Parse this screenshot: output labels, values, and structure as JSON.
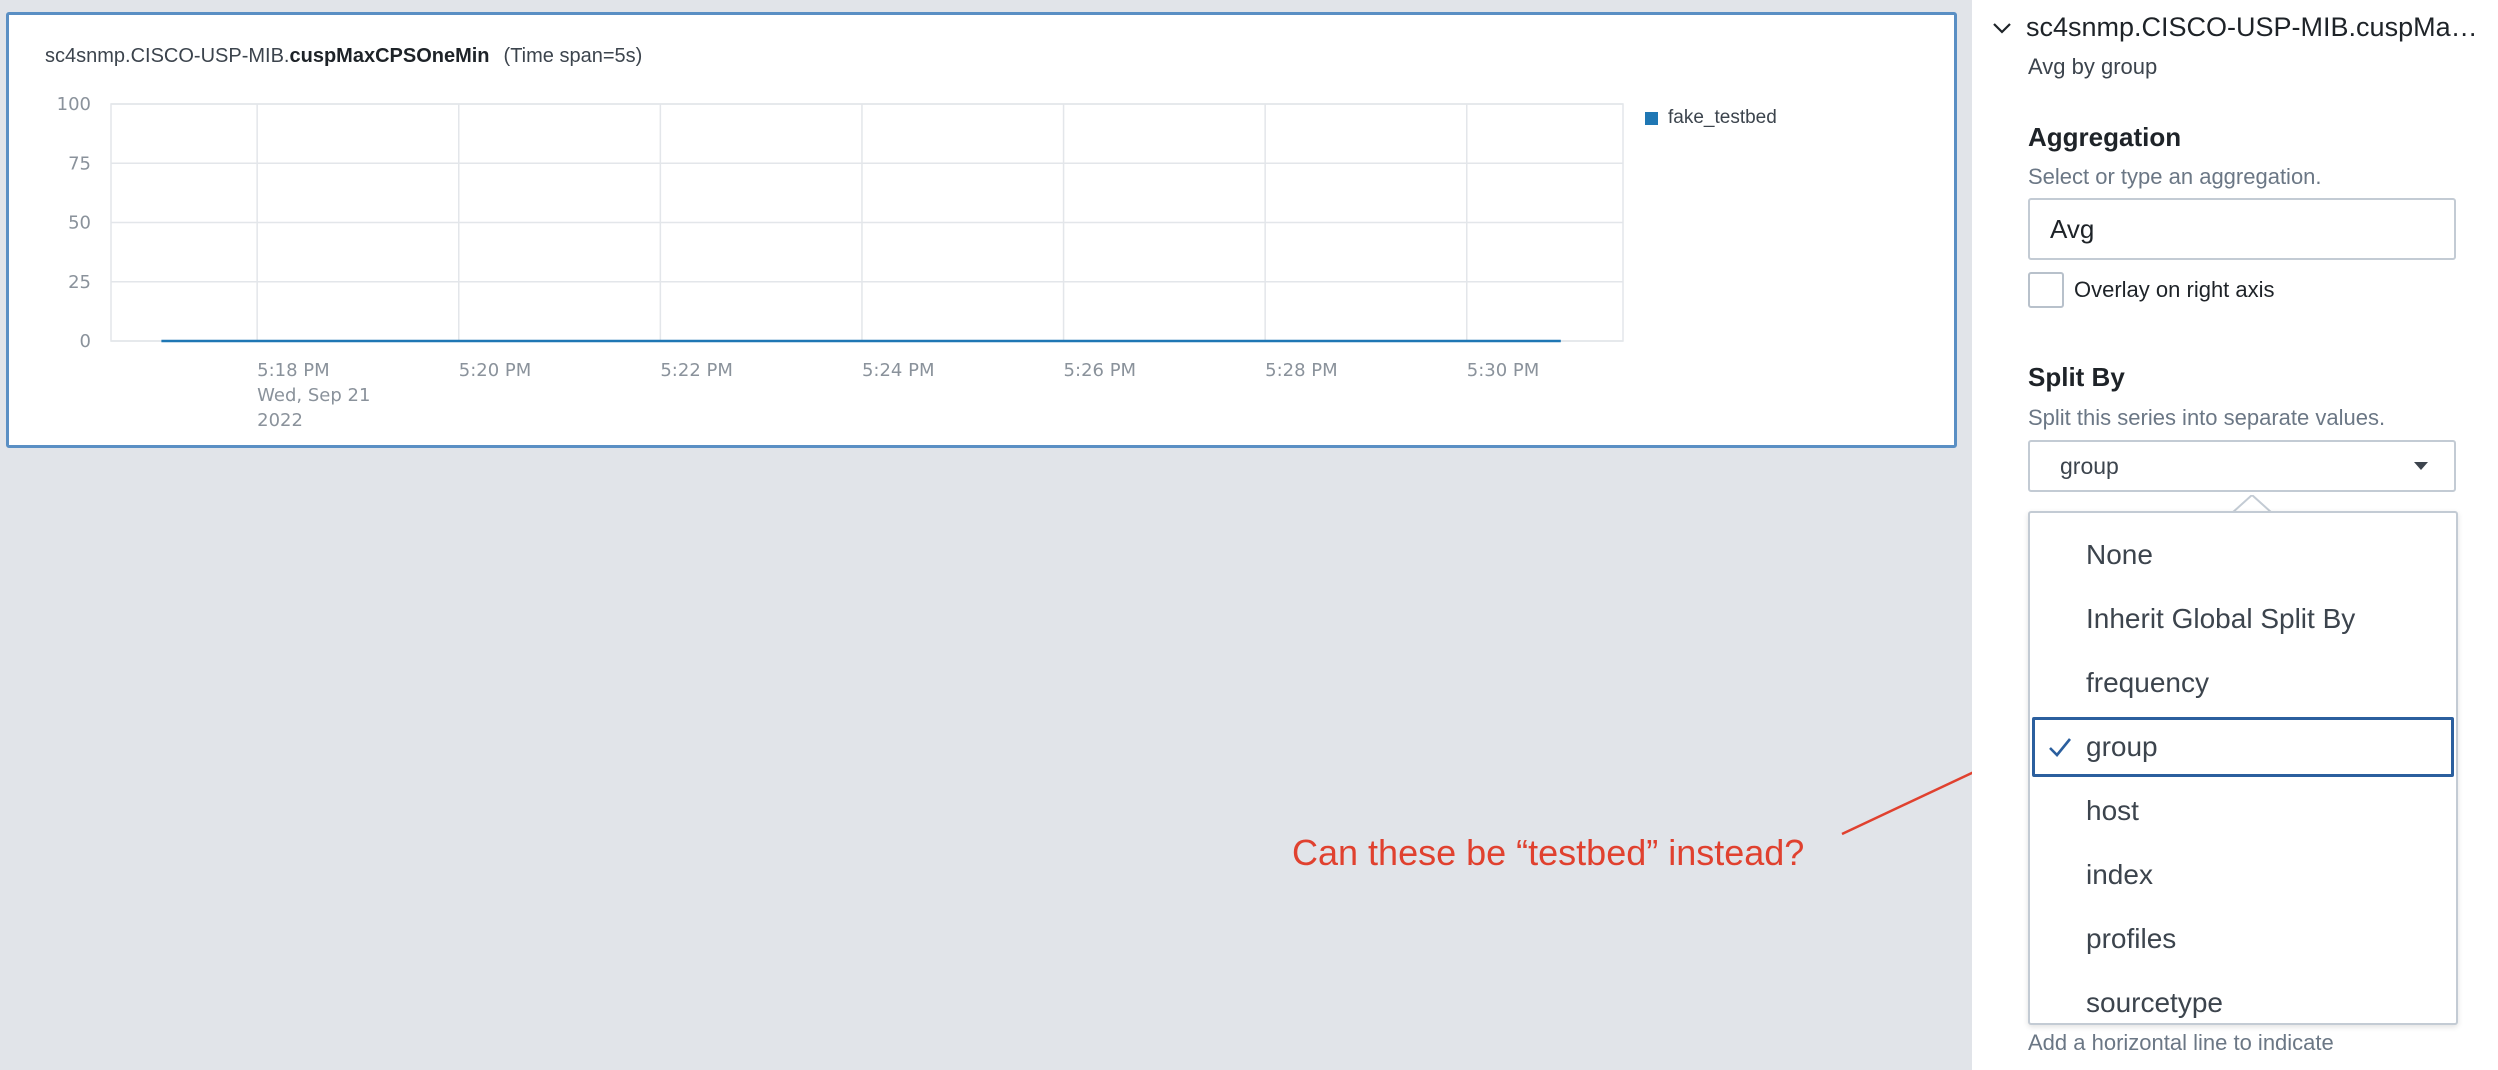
{
  "chart": {
    "metric_prefix": "sc4snmp.CISCO-USP-MIB.",
    "metric_name": "cuspMaxCPSOneMin",
    "time_span": "(Time span=5s)",
    "legend": [
      {
        "name": "fake_testbed",
        "color": "#1f77b4"
      }
    ]
  },
  "chart_data": {
    "type": "line",
    "title": "sc4snmp.CISCO-USP-MIB.cuspMaxCPSOneMin (Time span=5s)",
    "x_ticks": [
      "5:18 PM",
      "5:20 PM",
      "5:22 PM",
      "5:24 PM",
      "5:26 PM",
      "5:28 PM",
      "5:30 PM"
    ],
    "x_tick_sub": [
      "Wed, Sep 21",
      "2022"
    ],
    "x_range": [
      "5:16:33 PM",
      "5:31:33 PM"
    ],
    "y_ticks": [
      0,
      25,
      50,
      75,
      100
    ],
    "ylim": [
      0,
      100
    ],
    "grid": true,
    "legend_position": "right",
    "series": [
      {
        "name": "fake_testbed",
        "color": "#1f77b4",
        "x": [
          "5:17:03 PM",
          "5:30:56 PM"
        ],
        "values": [
          0,
          0
        ]
      }
    ]
  },
  "annotation": {
    "text": "Can these be “testbed” instead?",
    "color": "#e0412f"
  },
  "side_panel": {
    "series_title": "sc4snmp.CISCO-USP-MIB.cuspMaxC...",
    "series_subtitle": "Avg by group",
    "aggregation": {
      "title": "Aggregation",
      "help": "Select or type an aggregation.",
      "value": "Avg",
      "overlay_label": "Overlay on right axis"
    },
    "split_by": {
      "title": "Split By",
      "help": "Split this series into separate values.",
      "selected": "group",
      "options": [
        "None",
        "Inherit Global Split By",
        "frequency",
        "group",
        "host",
        "index",
        "profiles",
        "sourcetype"
      ],
      "selected_index": 3
    },
    "threshold_help": "Add a horizontal line to indicate"
  }
}
